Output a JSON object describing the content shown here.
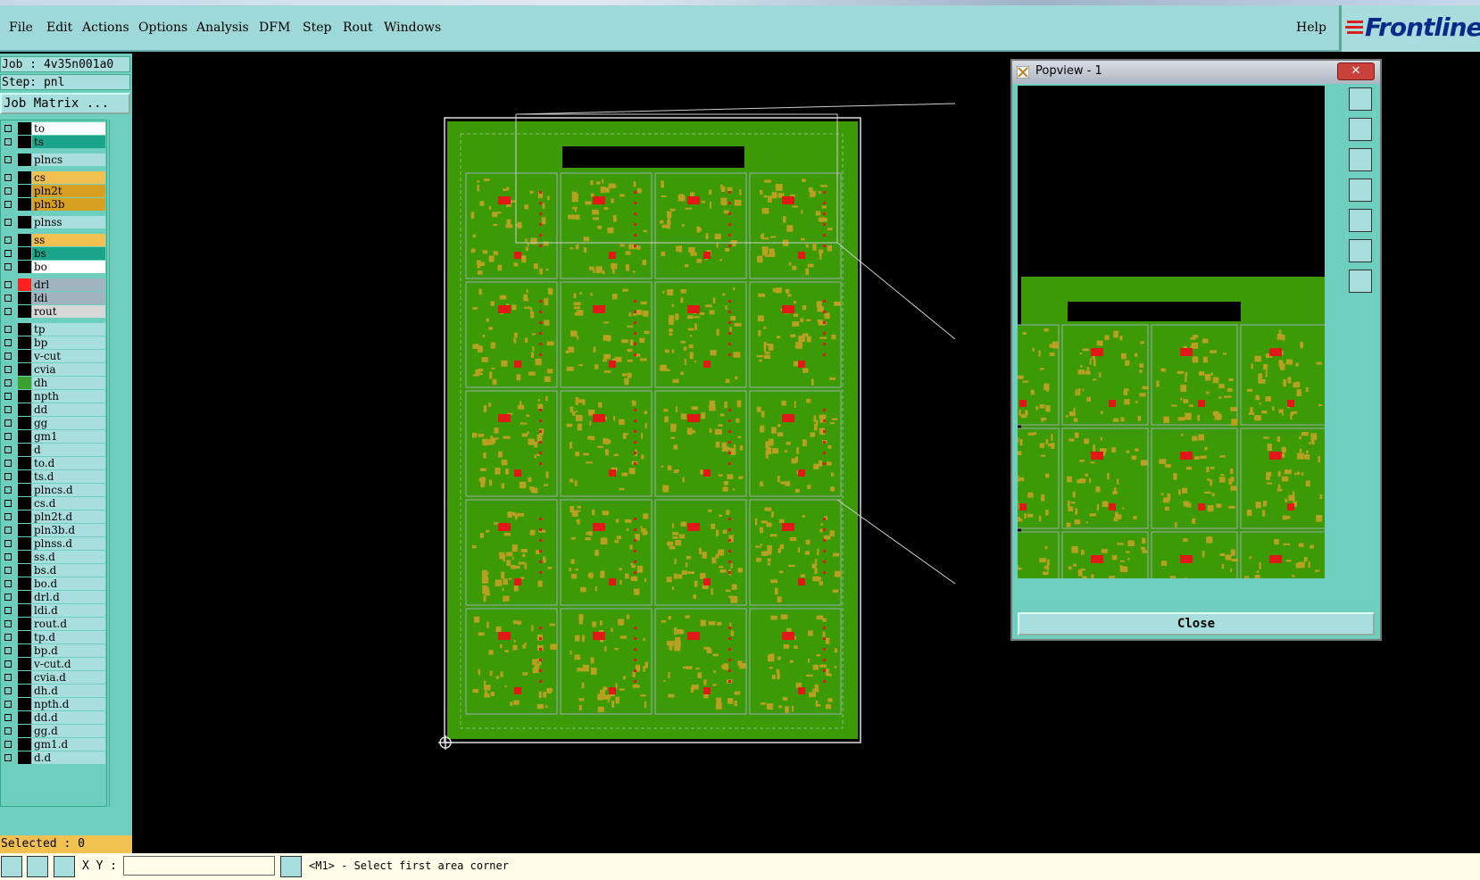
{
  "menu": {
    "items": [
      "File",
      "Edit",
      "Actions",
      "Options",
      "Analysis",
      "DFM",
      "Step",
      "Rout",
      "Windows"
    ],
    "help": "Help"
  },
  "logo": {
    "text": "Frontline"
  },
  "job": {
    "job_line": "Job : 4v35n001a0",
    "step_line": "Step: pnl",
    "matrix_button": "Job Matrix ..."
  },
  "layers": [
    {
      "name": "to",
      "color": "#000000",
      "bg": "#ffffff"
    },
    {
      "name": "ts",
      "color": "#000000",
      "bg": "#1aa58a"
    },
    {
      "name": "plncs",
      "color": "#000000",
      "bg": "#a8dede"
    },
    {
      "name": "cs",
      "color": "#000000",
      "bg": "#f0c050"
    },
    {
      "name": "pln2t",
      "color": "#000000",
      "bg": "#d8a020"
    },
    {
      "name": "pln3b",
      "color": "#000000",
      "bg": "#d8a020"
    },
    {
      "name": "plnss",
      "color": "#000000",
      "bg": "#a8dede"
    },
    {
      "name": "ss",
      "color": "#000000",
      "bg": "#f0c050"
    },
    {
      "name": "bs",
      "color": "#000000",
      "bg": "#1aa58a"
    },
    {
      "name": "bo",
      "color": "#000000",
      "bg": "#ffffff"
    },
    {
      "name": "drl",
      "color": "#ff2020",
      "bg": "#a0b4c0"
    },
    {
      "name": "ldi",
      "color": "#000000",
      "bg": "#a0b4c0"
    },
    {
      "name": "rout",
      "color": "#000000",
      "bg": "#d8d8d8"
    },
    {
      "name": "tp",
      "color": "#000000",
      "bg": "#a8dede"
    },
    {
      "name": "bp",
      "color": "#000000",
      "bg": "#a8dede"
    },
    {
      "name": "v-cut",
      "color": "#000000",
      "bg": "#a8dede"
    },
    {
      "name": "cvia",
      "color": "#000000",
      "bg": "#a8dede"
    },
    {
      "name": "dh",
      "color": "#3ca030",
      "bg": "#a8dede"
    },
    {
      "name": "npth",
      "color": "#000000",
      "bg": "#a8dede"
    },
    {
      "name": "dd",
      "color": "#000000",
      "bg": "#a8dede"
    },
    {
      "name": "gg",
      "color": "#000000",
      "bg": "#a8dede"
    },
    {
      "name": "gm1",
      "color": "#000000",
      "bg": "#a8dede"
    },
    {
      "name": "d",
      "color": "#000000",
      "bg": "#a8dede"
    },
    {
      "name": "to.d",
      "color": "#000000",
      "bg": "#a8dede"
    },
    {
      "name": "ts.d",
      "color": "#000000",
      "bg": "#a8dede"
    },
    {
      "name": "plncs.d",
      "color": "#000000",
      "bg": "#a8dede"
    },
    {
      "name": "cs.d",
      "color": "#000000",
      "bg": "#a8dede"
    },
    {
      "name": "pln2t.d",
      "color": "#000000",
      "bg": "#a8dede"
    },
    {
      "name": "pln3b.d",
      "color": "#000000",
      "bg": "#a8dede"
    },
    {
      "name": "plnss.d",
      "color": "#000000",
      "bg": "#a8dede"
    },
    {
      "name": "ss.d",
      "color": "#000000",
      "bg": "#a8dede"
    },
    {
      "name": "bs.d",
      "color": "#000000",
      "bg": "#a8dede"
    },
    {
      "name": "bo.d",
      "color": "#000000",
      "bg": "#a8dede"
    },
    {
      "name": "drl.d",
      "color": "#000000",
      "bg": "#a8dede"
    },
    {
      "name": "ldi.d",
      "color": "#000000",
      "bg": "#a8dede"
    },
    {
      "name": "rout.d",
      "color": "#000000",
      "bg": "#a8dede"
    },
    {
      "name": "tp.d",
      "color": "#000000",
      "bg": "#a8dede"
    },
    {
      "name": "bp.d",
      "color": "#000000",
      "bg": "#a8dede"
    },
    {
      "name": "v-cut.d",
      "color": "#000000",
      "bg": "#a8dede"
    },
    {
      "name": "cvia.d",
      "color": "#000000",
      "bg": "#a8dede"
    },
    {
      "name": "dh.d",
      "color": "#000000",
      "bg": "#a8dede"
    },
    {
      "name": "npth.d",
      "color": "#000000",
      "bg": "#a8dede"
    },
    {
      "name": "dd.d",
      "color": "#000000",
      "bg": "#a8dede"
    },
    {
      "name": "gg.d",
      "color": "#000000",
      "bg": "#a8dede"
    },
    {
      "name": "gm1.d",
      "color": "#000000",
      "bg": "#a8dede"
    },
    {
      "name": "d.d",
      "color": "#000000",
      "bg": "#a8dede"
    }
  ],
  "selected": "Selected : 0",
  "bottom": {
    "xy_label": "X Y :",
    "xy_value": "",
    "status": "<M1> - Select first area corner"
  },
  "popview": {
    "title": "Popview - 1",
    "close_label": "Close",
    "close_x": "✕"
  },
  "colors": {
    "board": "#3c9a06",
    "component": "#b8a020",
    "pad": "#e01818",
    "panel_bg": "#6fcfbf",
    "menu_bg": "#9fd8d8"
  }
}
